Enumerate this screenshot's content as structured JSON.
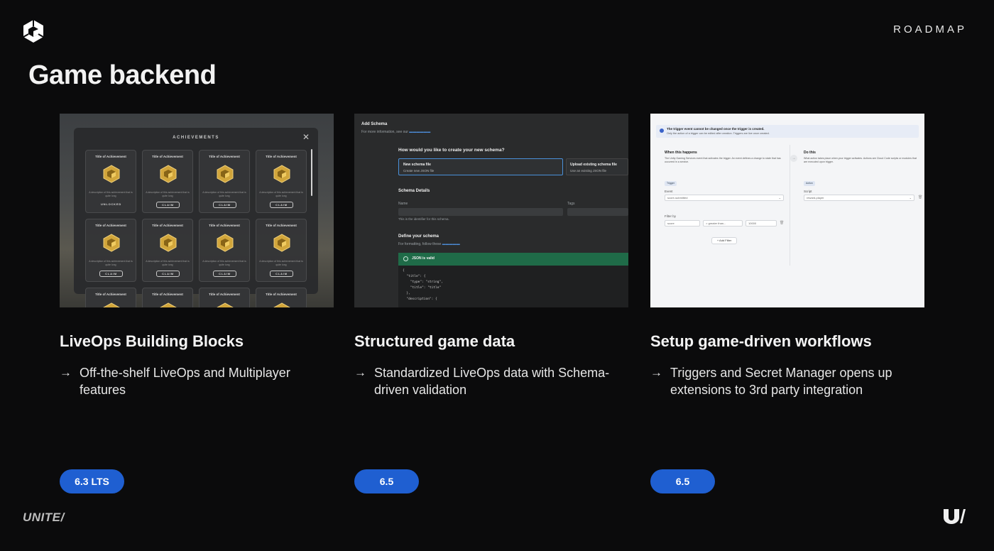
{
  "header": {
    "section_label": "ROADMAP",
    "title": "Game backend"
  },
  "cards": [
    {
      "title": "LiveOps Building Blocks",
      "bullet": "Off-the-shelf LiveOps and Multiplayer features",
      "version": "6.3 LTS",
      "screenshot": {
        "heading": "ACHIEVEMENTS",
        "tile_title": "Title of Achievement",
        "tile_desc": "A description of this achievement that is quite long",
        "unlocked_label": "UNLOCKED",
        "claim_label": "CLAIM"
      }
    },
    {
      "title": "Structured game data",
      "bullet": "Standardized LiveOps data with Schema-driven validation",
      "version": "6.5",
      "screenshot": {
        "page_title": "Add Schema",
        "subtitle": "For more information, see our",
        "question": "How would you like to create your new schema?",
        "option_new_title": "New schema file",
        "option_new_sub": "Create new JSON file",
        "option_upload_title": "Upload existing schema file",
        "option_upload_sub": "Use an existing JSON file",
        "details_heading": "Schema Details",
        "name_label": "Name",
        "tags_label": "Tags",
        "name_hint": "This is the identifier for this schema.",
        "define_heading": "Define your schema",
        "define_hint": "For formatting, follow these",
        "valid_label": "JSON is valid",
        "code_lines": [
          "{",
          "  \"title\": {",
          "    \"type\": \"string\",",
          "    \"title\": \"title\"",
          "  },",
          "  \"description\": {"
        ]
      }
    },
    {
      "title": "Setup game-driven workflows",
      "bullet": "Triggers and Secret Manager opens up extensions to 3rd party integration",
      "version": "6.5",
      "screenshot": {
        "banner_title": "The trigger event cannot be changed once the trigger is created.",
        "banner_sub": "Only the action of a trigger can be edited after creation. Triggers are live once created.",
        "left_heading": "When this happens",
        "left_desc": "The Unity Gaming Services event that activates the trigger. An event defines a change to state that has occurred in a service.",
        "right_heading": "Do this",
        "right_desc": "What action takes place when your trigger activates. Actions are Cloud Code scripts or modules that are executed upon trigger.",
        "trigger_tag": "Trigger",
        "action_tag": "Action",
        "event_label": "Event",
        "event_value": "score-submitted",
        "script_label": "Script",
        "script_value": "reward-player",
        "filter_label": "Filter by",
        "filter_field": "score",
        "filter_op": "> greater than...",
        "filter_value": "10000",
        "add_filter": "+ Add Filter"
      }
    }
  ],
  "footer": {
    "brand": "UNITE/"
  }
}
